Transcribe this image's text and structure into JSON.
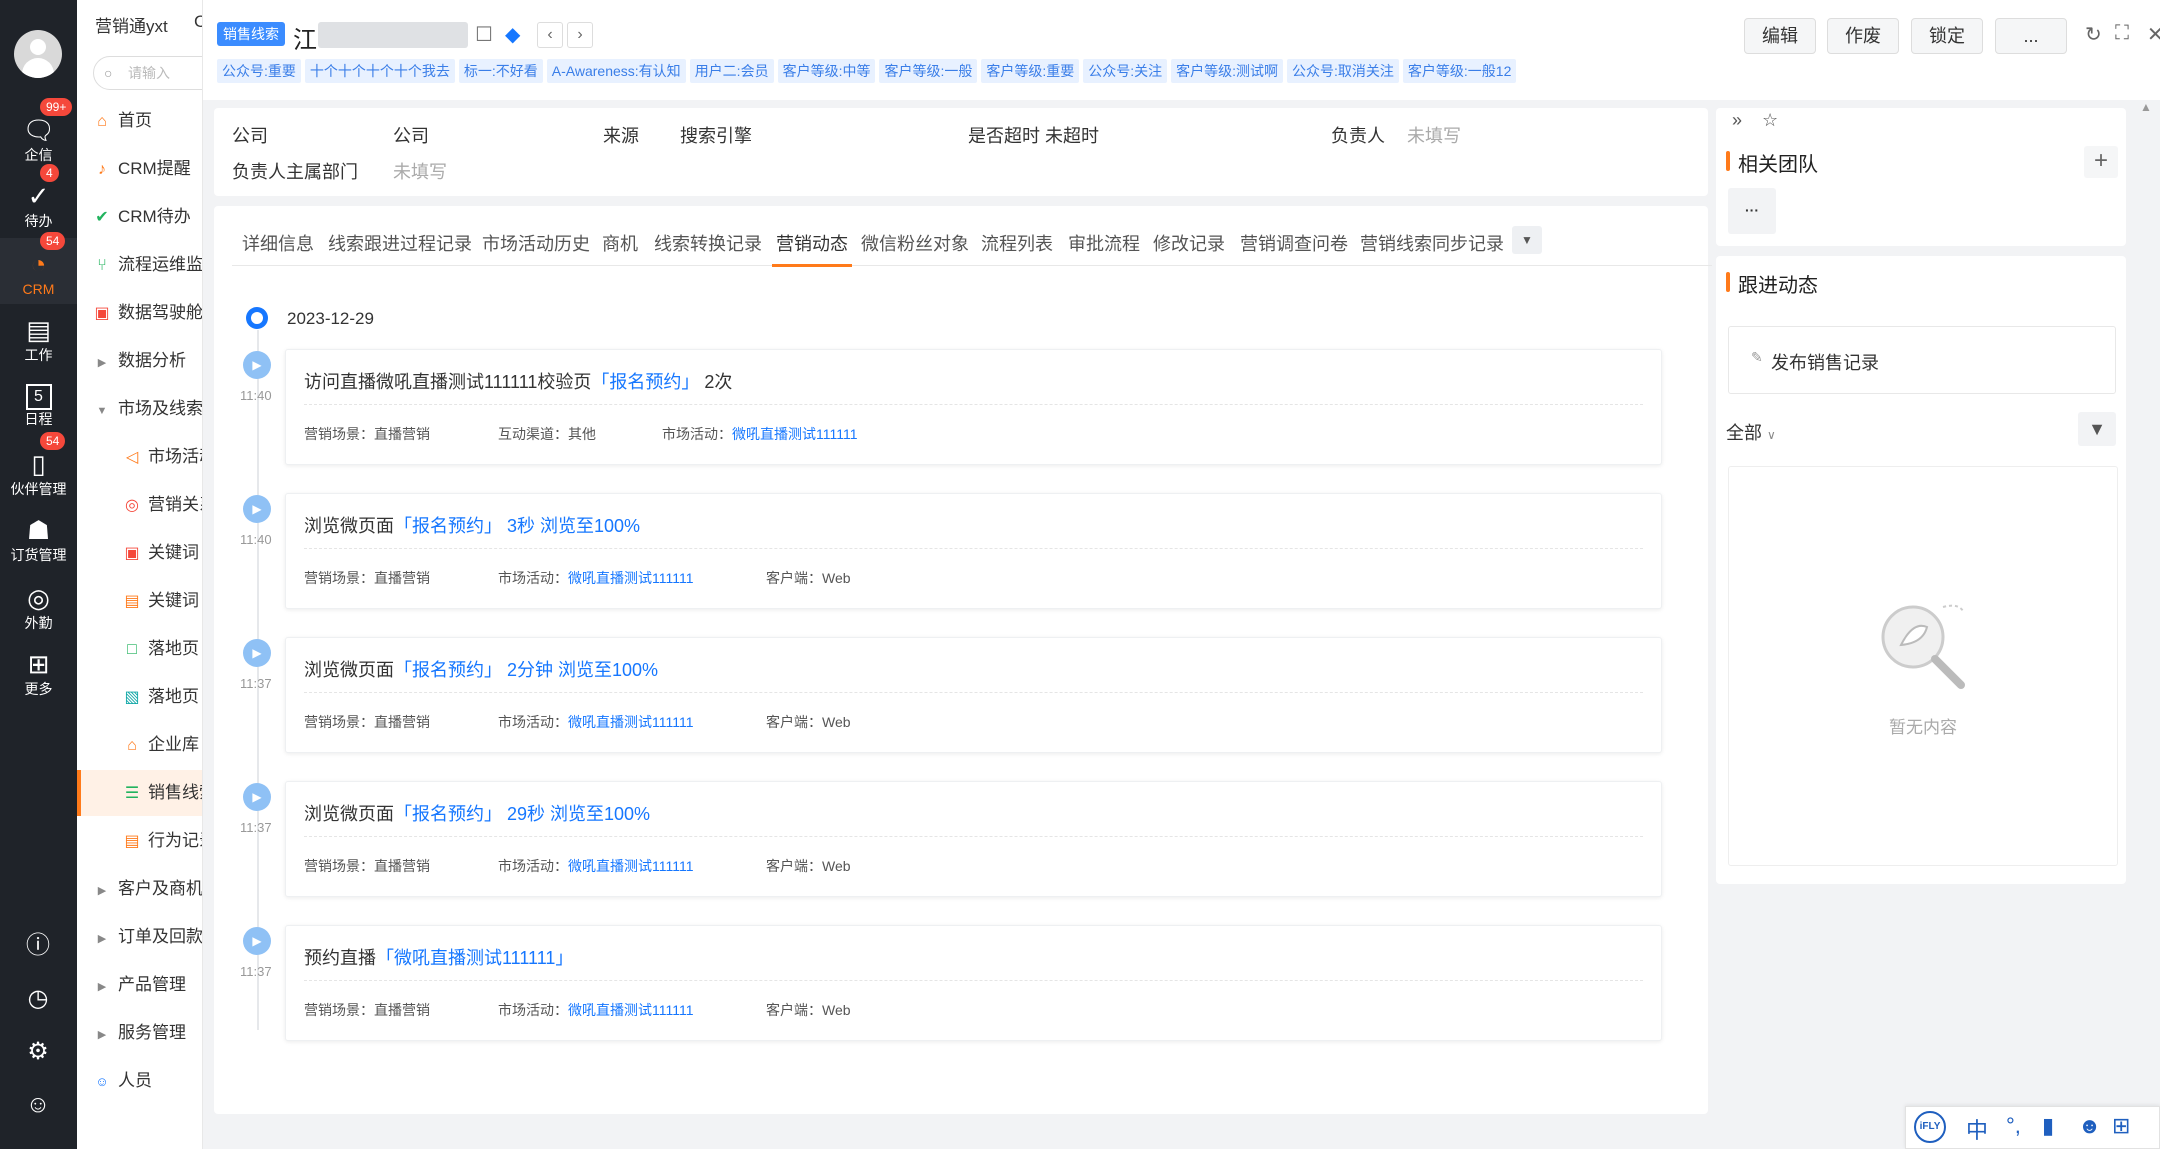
{
  "rail": {
    "items": [
      {
        "label": "企信",
        "badge": "99+"
      },
      {
        "label": "待办",
        "badge": "4"
      },
      {
        "label": "CRM",
        "badge": "54"
      },
      {
        "label": "工作",
        "badge": ""
      },
      {
        "label": "日程",
        "badge": ""
      },
      {
        "label": "伙伴管理",
        "badge": "54"
      },
      {
        "label": "订货管理",
        "badge": ""
      },
      {
        "label": "外勤",
        "badge": ""
      },
      {
        "label": "更多",
        "badge": ""
      }
    ],
    "calendar_day": "5"
  },
  "nav": {
    "brand": "营销通yxt",
    "brand_suffix": "C",
    "search_placeholder": "请输入",
    "items": [
      {
        "label": "首页"
      },
      {
        "label": "CRM提醒"
      },
      {
        "label": "CRM待办"
      },
      {
        "label": "流程运维监控"
      },
      {
        "label": "数据驾驶舱"
      },
      {
        "label": "数据分析"
      },
      {
        "label": "市场及线索"
      },
      {
        "label": "市场活动"
      },
      {
        "label": "营销关系"
      },
      {
        "label": "关键词"
      },
      {
        "label": "关键词"
      },
      {
        "label": "落地页"
      },
      {
        "label": "落地页"
      },
      {
        "label": "企业库"
      },
      {
        "label": "销售线索"
      },
      {
        "label": "行为记录"
      },
      {
        "label": "客户及商机"
      },
      {
        "label": "订单及回款"
      },
      {
        "label": "产品管理"
      },
      {
        "label": "服务管理"
      },
      {
        "label": "人员"
      }
    ]
  },
  "header": {
    "object_type": "销售线索",
    "title_first_char": "江",
    "tags": [
      "公众号:重要",
      "十个十个十个十个我去",
      "标一:不好看",
      "A-Awareness:有认知",
      "用户二:会员",
      "客户等级:中等",
      "客户等级:一般",
      "客户等级:重要",
      "公众号:关注",
      "客户等级:测试啊",
      "公众号:取消关注",
      "客户等级:一般12"
    ],
    "actions": {
      "edit": "编辑",
      "void": "作废",
      "lock": "锁定",
      "more": "..."
    }
  },
  "summary": {
    "company_label": "公司",
    "company_value": "公司",
    "source_label": "来源",
    "source_value": "搜索引擎",
    "overdue_label": "是否超时",
    "overdue_value": "未超时",
    "owner_label": "负责人",
    "owner_value": "未填写",
    "dept_label": "负责人主属部门",
    "dept_value": "未填写"
  },
  "tabs": [
    "详细信息",
    "线索跟进过程记录",
    "市场活动历史",
    "商机",
    "线索转换记录",
    "营销动态",
    "微信粉丝对象",
    "流程列表",
    "审批流程",
    "修改记录",
    "营销调查问卷",
    "营销线索同步记录"
  ],
  "timeline": {
    "date": "2023-12-29",
    "events": [
      {
        "time": "11:40",
        "title_pre": "访问直播微吼直播测试111111校验页",
        "link": "「报名预约」",
        "title_post": "2次",
        "meta": [
          {
            "label": "营销场景：",
            "value": "直播营销",
            "link": false
          },
          {
            "label": "互动渠道：",
            "value": "其他",
            "link": false
          },
          {
            "label": "市场活动：",
            "value": "微吼直播测试111111",
            "link": true
          }
        ]
      },
      {
        "time": "11:40",
        "title_pre": "浏览微页面",
        "link": "「报名预约」 3秒 浏览至100%",
        "title_post": "",
        "meta": [
          {
            "label": "营销场景：",
            "value": "直播营销",
            "link": false
          },
          {
            "label": "市场活动：",
            "value": "微吼直播测试111111",
            "link": true
          },
          {
            "label": "客户端：",
            "value": "Web",
            "link": false
          }
        ]
      },
      {
        "time": "11:37",
        "title_pre": "浏览微页面",
        "link": "「报名预约」 2分钟 浏览至100%",
        "title_post": "",
        "meta": [
          {
            "label": "营销场景：",
            "value": "直播营销",
            "link": false
          },
          {
            "label": "市场活动：",
            "value": "微吼直播测试111111",
            "link": true
          },
          {
            "label": "客户端：",
            "value": "Web",
            "link": false
          }
        ]
      },
      {
        "time": "11:37",
        "title_pre": "浏览微页面",
        "link": "「报名预约」 29秒 浏览至100%",
        "title_post": "",
        "meta": [
          {
            "label": "营销场景：",
            "value": "直播营销",
            "link": false
          },
          {
            "label": "市场活动：",
            "value": "微吼直播测试111111",
            "link": true
          },
          {
            "label": "客户端：",
            "value": "Web",
            "link": false
          }
        ]
      },
      {
        "time": "11:37",
        "title_pre": "预约直播",
        "link": "「微吼直播测试111111」",
        "title_post": "",
        "meta": [
          {
            "label": "营销场景：",
            "value": "直播营销",
            "link": false
          },
          {
            "label": "市场活动：",
            "value": "微吼直播测试111111",
            "link": true
          },
          {
            "label": "客户端：",
            "value": "Web",
            "link": false
          }
        ]
      }
    ]
  },
  "side": {
    "team_title": "相关团队",
    "team_more": "···",
    "followup_title": "跟进动态",
    "publish_label": "发布销售记录",
    "filter_label": "全部",
    "empty_text": "暂无内容"
  },
  "ime": {
    "lang": "中"
  }
}
